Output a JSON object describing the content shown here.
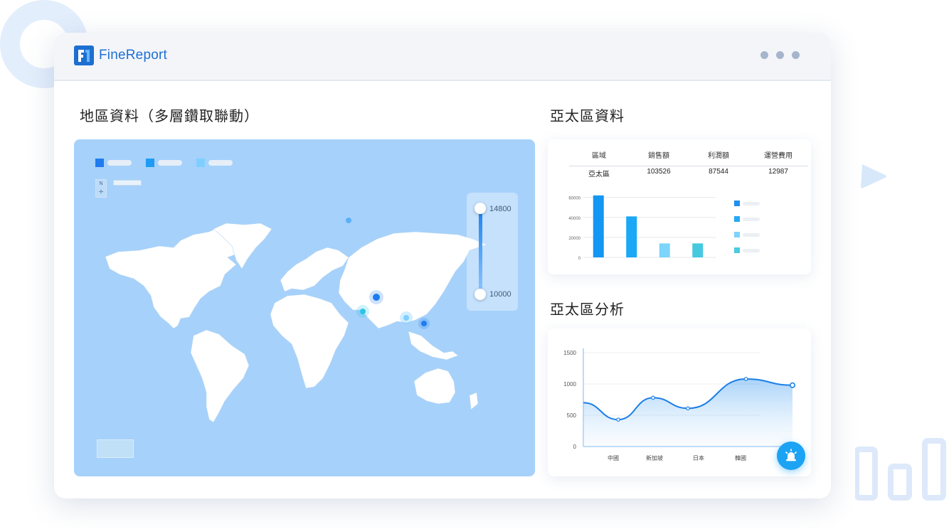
{
  "app": {
    "logo_text": "FineReport"
  },
  "window": {
    "dots": [
      "dot",
      "dot",
      "dot"
    ]
  },
  "map_section": {
    "title": "地區資料（多層鑽取聯動）",
    "legend_colors": [
      "#1f7cf0",
      "#1f9bf5",
      "#7ecfff"
    ],
    "slider": {
      "max_label": "14800",
      "min_label": "10000"
    }
  },
  "asia_section": {
    "title": "亞太區資料",
    "table": {
      "headers": [
        "區域",
        "銷售額",
        "利潤額",
        "運營費用"
      ],
      "rows": [
        [
          "亞太區",
          "103526",
          "87544",
          "12987"
        ]
      ]
    },
    "bar_legend_colors": [
      "#1f8fee",
      "#24a9f5",
      "#7ed3fb",
      "#4acbe0"
    ]
  },
  "analysis_section": {
    "title": "亞太區分析"
  },
  "chart_data": [
    {
      "type": "bar",
      "categories": [
        "",
        "",
        "",
        ""
      ],
      "values": [
        62000,
        41000,
        14000,
        14000
      ],
      "colors": [
        "#1496f3",
        "#1ca8f6",
        "#7dd5fb",
        "#46c9df"
      ],
      "yticks": [
        "60000",
        "40000",
        "20000",
        "0"
      ],
      "ylim": [
        0,
        64000
      ],
      "grid": true,
      "legend": "right"
    },
    {
      "type": "area",
      "categories": [
        "中國",
        "新加坡",
        "日本",
        "韓國"
      ],
      "yticks": [
        "1500",
        "1000",
        "500",
        "0"
      ],
      "ylim": [
        0,
        1500
      ],
      "series": [
        {
          "x": [
            0,
            0.6,
            1.2,
            1.8,
            2.8,
            3.6
          ],
          "values": [
            700,
            430,
            780,
            610,
            1080,
            980
          ]
        }
      ],
      "grid": true
    }
  ],
  "fab": {
    "icon": "alarm-icon"
  }
}
